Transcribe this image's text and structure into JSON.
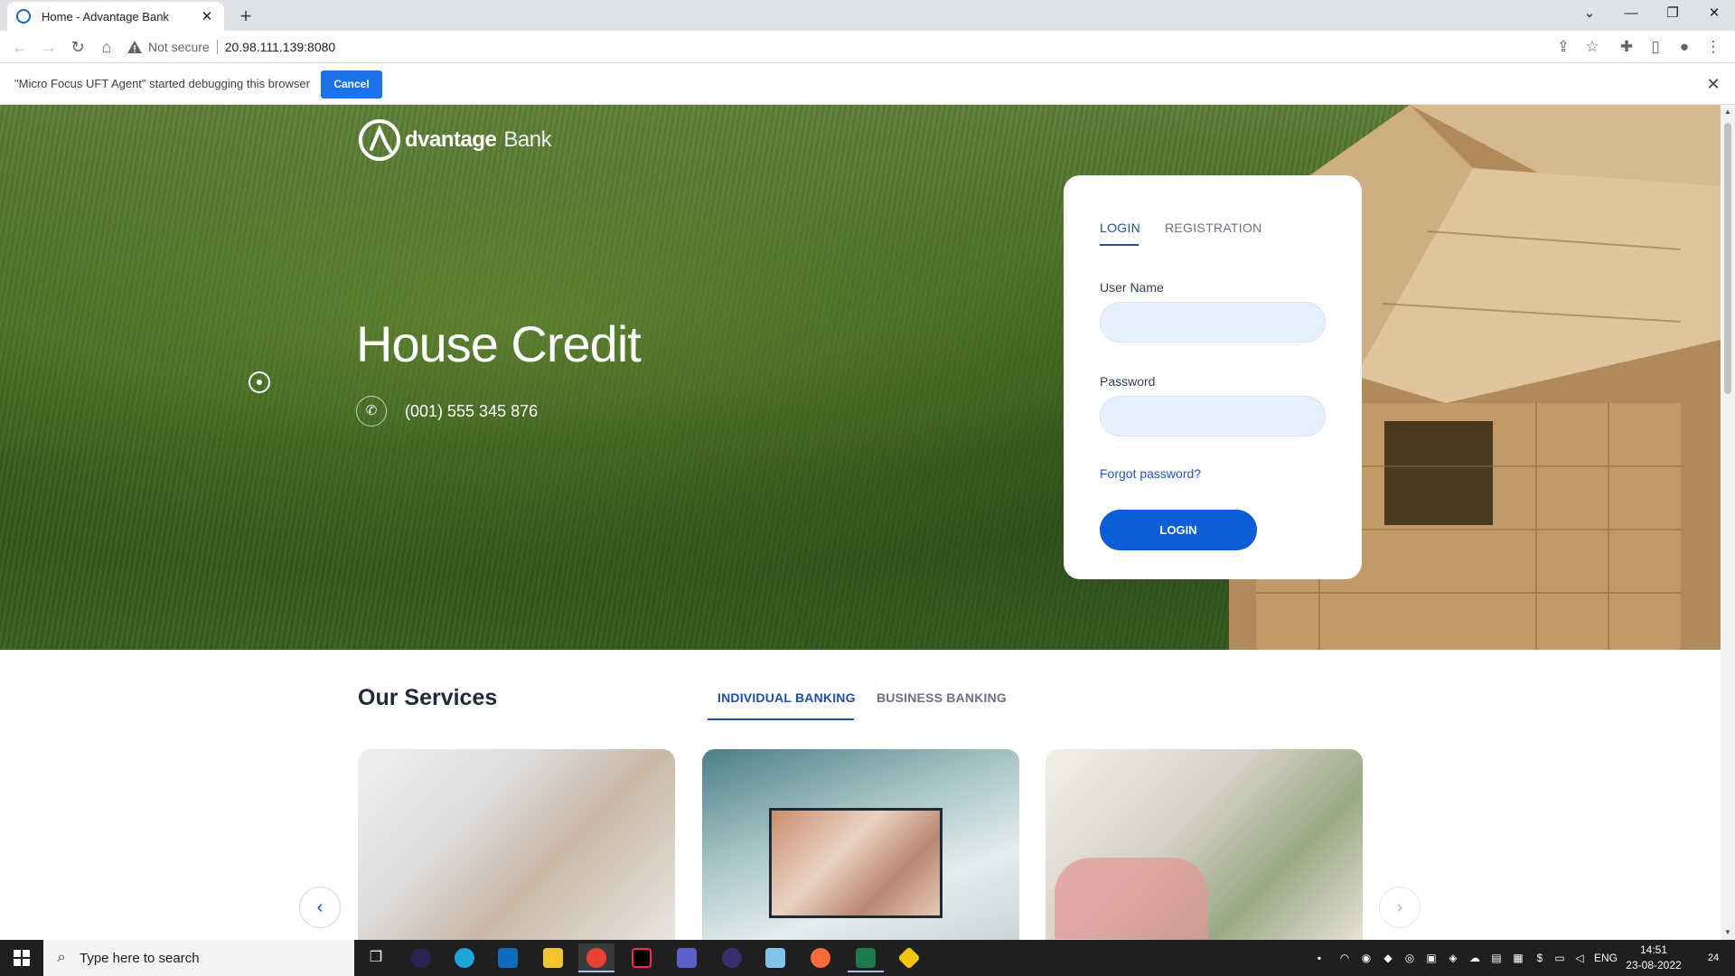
{
  "browser": {
    "tab_title": "Home - Advantage Bank",
    "tab_close": "✕",
    "new_tab": "+",
    "security_label": "Not secure",
    "url": "20.98.111.139:8080",
    "min": "—",
    "max": "❐",
    "close": "✕",
    "tab_search": "⌄"
  },
  "infobar": {
    "message": "\"Micro Focus UFT Agent\" started debugging this browser",
    "cancel_label": "Cancel",
    "close": "✕"
  },
  "hero": {
    "brand_primary": "dvantage",
    "brand_secondary": "Bank",
    "title": "House Credit",
    "phone": "(001) 555 345 876",
    "phone_icon": "✆"
  },
  "login": {
    "tab_login": "LOGIN",
    "tab_registration": "REGISTRATION",
    "username_label": "User Name",
    "password_label": "Password",
    "forgot": "Forgot password?",
    "button": "LOGIN"
  },
  "services": {
    "title": "Our Services",
    "tab_individual": "INDIVIDUAL BANKING",
    "tab_business": "BUSINESS BANKING",
    "prev": "‹",
    "next": "›"
  },
  "taskbar": {
    "search_placeholder": "Type here to search",
    "language": "ENG",
    "time": "14:51",
    "date": "23-08-2022",
    "notifications": "24"
  },
  "colors": {
    "accent": "#0b5ed7",
    "tab_active": "#1e4fa6",
    "input_fill": "#e7f0fd"
  }
}
